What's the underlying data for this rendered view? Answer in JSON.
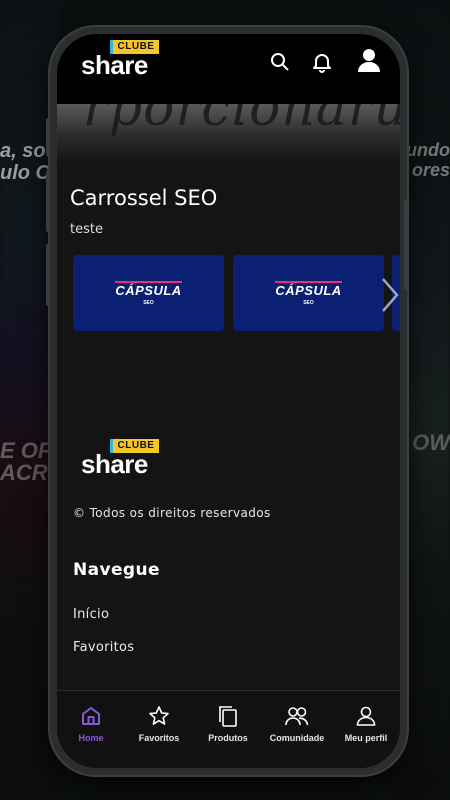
{
  "brand": {
    "clube": "CLUBE",
    "share": "share",
    "colors": {
      "yellow": "#f6c528",
      "cyan": "#2fb6e6",
      "accent_purple": "#8a57d8",
      "card_blue": "#0b1f73",
      "card_stripe": "#e4317a"
    }
  },
  "header": {
    "icons": [
      "search-icon",
      "bell-icon",
      "user-icon"
    ]
  },
  "hero": {
    "text": "rporcionarü"
  },
  "section": {
    "title": "Carrossel SEO",
    "subtitle": "teste",
    "cards": [
      {
        "title": "CÁPSULA",
        "sub": "SEO"
      },
      {
        "title": "CÁPSULA",
        "sub": "SEO"
      }
    ]
  },
  "footer": {
    "copyright": "© Todos os direitos reservados",
    "nav_heading": "Navegue",
    "links": [
      "Início",
      "Favoritos"
    ]
  },
  "bottom_nav": {
    "items": [
      {
        "label": "Home",
        "icon": "home-icon",
        "active": true
      },
      {
        "label": "Favoritos",
        "icon": "star-icon"
      },
      {
        "label": "Produtos",
        "icon": "copy-icon"
      },
      {
        "label": "Comunidade",
        "icon": "community-icon"
      },
      {
        "label": "Meu perfil",
        "icon": "profile-icon"
      }
    ]
  },
  "background": {
    "left_top": "a, sou\nulo Co",
    "left_bottom": "E OF\nACR",
    "right_top": "undo\nores",
    "right_bottom": "OW"
  }
}
